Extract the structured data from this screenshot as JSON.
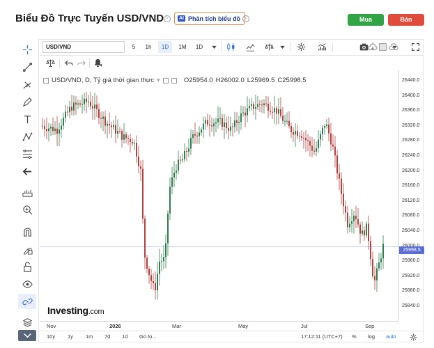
{
  "header": {
    "title": "Biểu Đồ Trực Tuyến USD/VND",
    "analysis_label": "Phân tích biểu đồ",
    "ai_badge": "AI",
    "buy_label": "Mua",
    "sell_label": "Bán"
  },
  "toolbar": {
    "symbol": "USD/VND",
    "timeframes": [
      "5",
      "1h",
      "1D",
      "1M",
      "1D"
    ],
    "active_timeframe": "1D"
  },
  "legend": {
    "title": "USD/VND, D, Tỷ giá thời gian thực",
    "open": "O25954.0",
    "high": "H26002.0",
    "low": "L25969.5",
    "close": "C25998.5"
  },
  "price_axis": {
    "ticks": [
      "26440.0",
      "26400.0",
      "26360.0",
      "26320.0",
      "26280.0",
      "26240.0",
      "26200.0",
      "26160.0",
      "26120.0",
      "26080.0",
      "26040.0",
      "26000.0",
      "25960.0",
      "25920.0",
      "25880.0",
      "25840.0"
    ],
    "current_price": "25998.5"
  },
  "time_axis": {
    "ticks": [
      "Nov",
      "2026",
      "Mar",
      "May",
      "Jul",
      "Sep"
    ]
  },
  "bottom_bar": {
    "ranges": [
      "10y",
      "1y",
      "1m",
      "7d",
      "1d"
    ],
    "goto_label": "Go to...",
    "clock": "17:12:11 (UTC+7)",
    "percent_label": "%",
    "log_label": "log",
    "auto_label": "auto"
  },
  "watermark": {
    "brand": "Investing",
    "domain": ".com"
  },
  "colors": {
    "up": "#2e7d4f",
    "down": "#b0413e",
    "buy": "#31a545",
    "sell": "#e04b3a",
    "price_badge": "#5b6ed6",
    "accent": "#2a6fdb"
  },
  "icons": [
    "crosshair-icon",
    "trendline-icon",
    "brush-icon",
    "pencil-icon",
    "text-icon",
    "pattern-icon",
    "fibonacci-icon",
    "arrow-left-icon",
    "ruler-icon",
    "zoom-icon",
    "magnet-icon",
    "lock-draw-icon",
    "unlock-icon",
    "eye-icon",
    "link-icon",
    "layers-icon",
    "chevron-down-icon"
  ]
}
